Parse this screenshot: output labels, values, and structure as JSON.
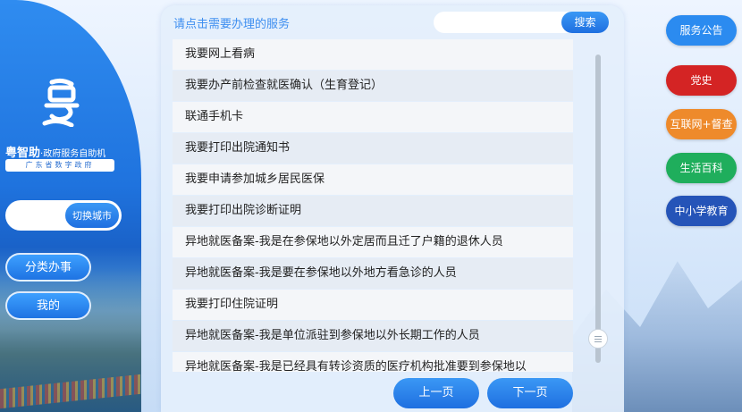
{
  "brand": {
    "name": "粤智助",
    "subtitle": "·政府服务自助机",
    "org": "广东省数字政府"
  },
  "left_nav": {
    "city_switch_label": "切换城市",
    "category_label": "分类办事",
    "mine_label": "我的"
  },
  "main": {
    "prompt": "请点击需要办理的服务",
    "search": {
      "value": "",
      "button_label": "搜索"
    },
    "services": [
      "我要网上看病",
      "我要办产前检查就医确认（生育登记）",
      "联通手机卡",
      "我要打印出院通知书",
      "我要申请参加城乡居民医保",
      "我要打印出院诊断证明",
      "异地就医备案-我是在参保地以外定居而且迁了户籍的退休人员",
      "异地就医备案-我是要在参保地以外地方看急诊的人员",
      "我要打印住院证明",
      "异地就医备案-我是单位派驻到参保地以外长期工作的人员",
      "异地就医备案-我是已经具有转诊资质的医疗机构批准要到参保地以"
    ],
    "scroll_position": 0.95,
    "prev_label": "上一页",
    "next_label": "下一页"
  },
  "right_nav": [
    {
      "label": "服务公告",
      "color": "#2b8bf0"
    },
    {
      "label": "党史",
      "color": "#d42424"
    },
    {
      "label": "互联网+督查",
      "color": "#ee8a2b"
    },
    {
      "label": "生活百科",
      "color": "#1fae5c"
    },
    {
      "label": "中小学教育",
      "color": "#2554b8"
    }
  ]
}
